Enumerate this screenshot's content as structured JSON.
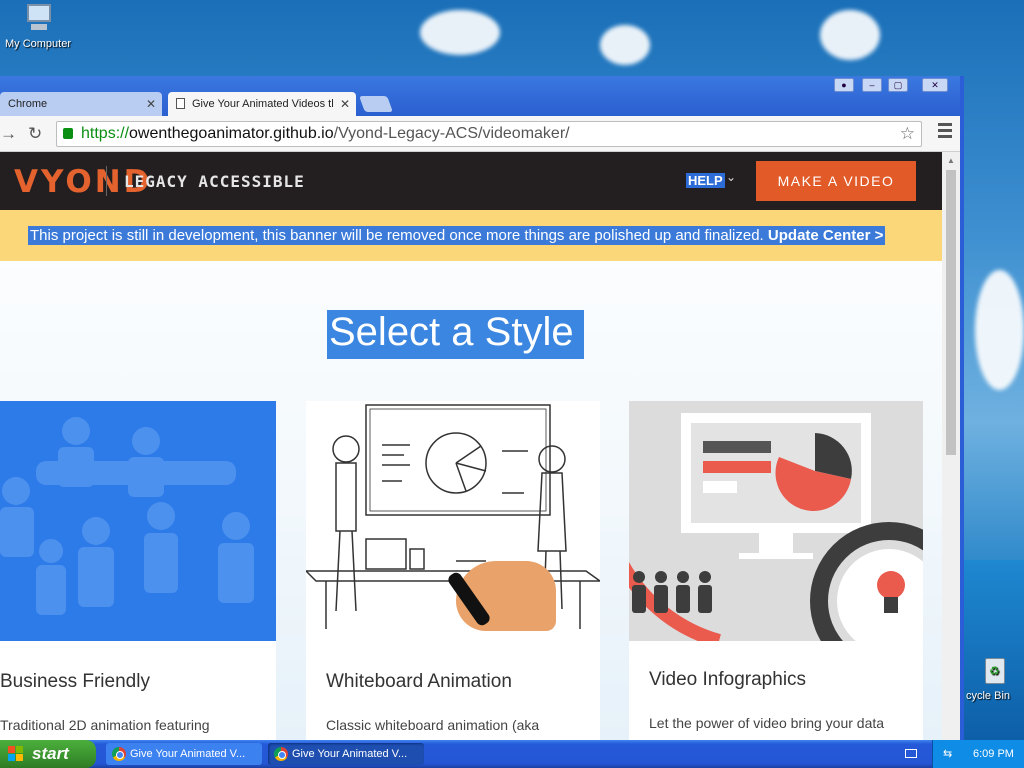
{
  "desktop": {
    "icons": [
      {
        "label": "My Computer"
      },
      {
        "label": "cycle Bin"
      }
    ]
  },
  "browser": {
    "tabs": [
      {
        "title": "Chrome",
        "active": false
      },
      {
        "title": "Give Your Animated Videos tl",
        "active": true
      }
    ],
    "url": {
      "scheme": "https://",
      "host": "owenthegoanimator.github.io",
      "path": "/Vyond-Legacy-ACS/videomaker/"
    }
  },
  "site": {
    "logo": "VYOND",
    "logo_sub": "LEGACY ACCESSIBLE",
    "help_label": "HELP",
    "make_video_label": "MAKE A VIDEO",
    "banner_text": "This project is still in development, this banner will be removed once more things are polished up and finalized.",
    "banner_link": "Update Center >",
    "heading": "Select a Style",
    "cards": [
      {
        "title": "Business Friendly",
        "desc": "Traditional 2D animation featuring"
      },
      {
        "title": "Whiteboard Animation",
        "desc": "Classic whiteboard animation (aka"
      },
      {
        "title": "Video Infographics",
        "desc": "Let the power of video bring your data"
      }
    ]
  },
  "taskbar": {
    "start_label": "start",
    "tasks": [
      {
        "label": "Give Your Animated V..."
      },
      {
        "label": "Give Your Animated V..."
      }
    ],
    "clock": "6:09 PM"
  },
  "colors": {
    "accent": "#e15a28",
    "nav_bg": "#231f20",
    "banner_bg": "#fcd77a",
    "selection": "#3b7ad9"
  }
}
